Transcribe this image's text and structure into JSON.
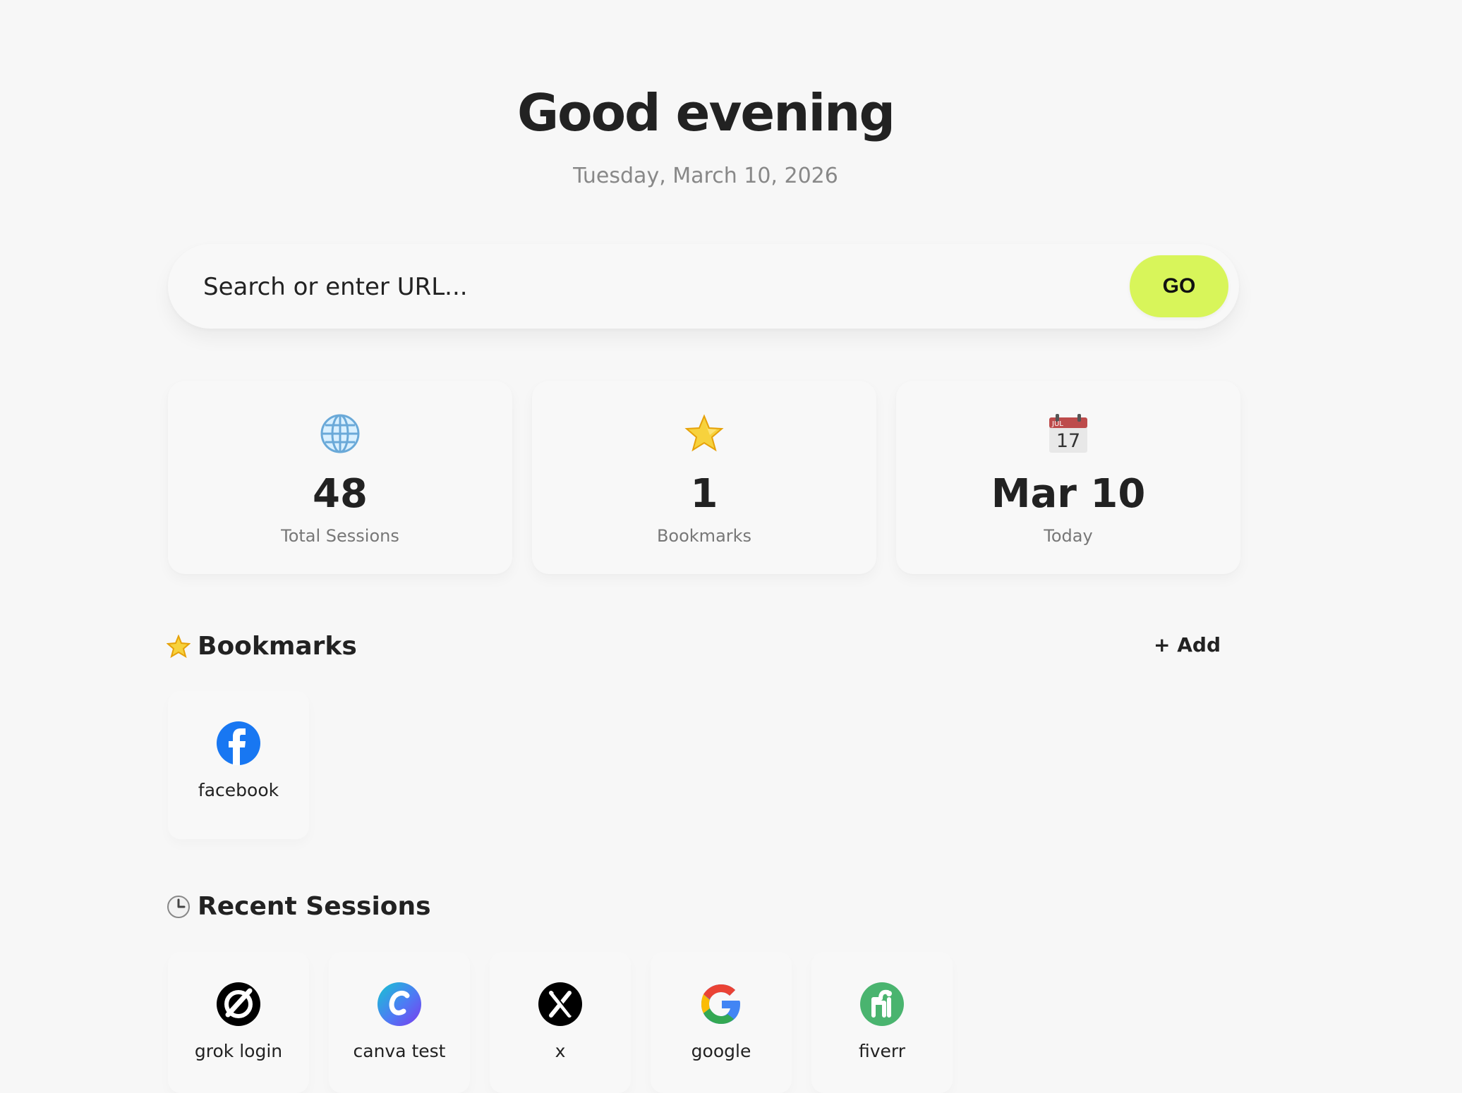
{
  "header": {
    "title": "Good evening",
    "date": "Tuesday, March 10, 2026"
  },
  "search": {
    "placeholder": "Search or enter URL...",
    "button_label": "GO"
  },
  "stats": [
    {
      "icon": "globe-icon",
      "value": "48",
      "label": "Total Sessions"
    },
    {
      "icon": "star-icon",
      "value": "1",
      "label": "Bookmarks"
    },
    {
      "icon": "calendar-icon",
      "value": "Mar 10",
      "label": "Today",
      "calendar_month": "JUL",
      "calendar_day": "17"
    }
  ],
  "bookmarks": {
    "title": "Bookmarks",
    "add_label": "+ Add",
    "items": [
      {
        "label": "facebook",
        "icon": "facebook-icon"
      }
    ]
  },
  "recent_sessions": {
    "title": "Recent Sessions",
    "items": [
      {
        "label": "grok login",
        "icon": "grok-icon"
      },
      {
        "label": "canva test",
        "icon": "canva-icon"
      },
      {
        "label": "x",
        "icon": "x-icon"
      },
      {
        "label": "google",
        "icon": "google-icon"
      },
      {
        "label": "fiverr",
        "icon": "fiverr-icon"
      }
    ]
  },
  "colors": {
    "background": "#f7f7f7",
    "accent": "#d8f55a",
    "text": "#222222",
    "muted": "#777777"
  }
}
